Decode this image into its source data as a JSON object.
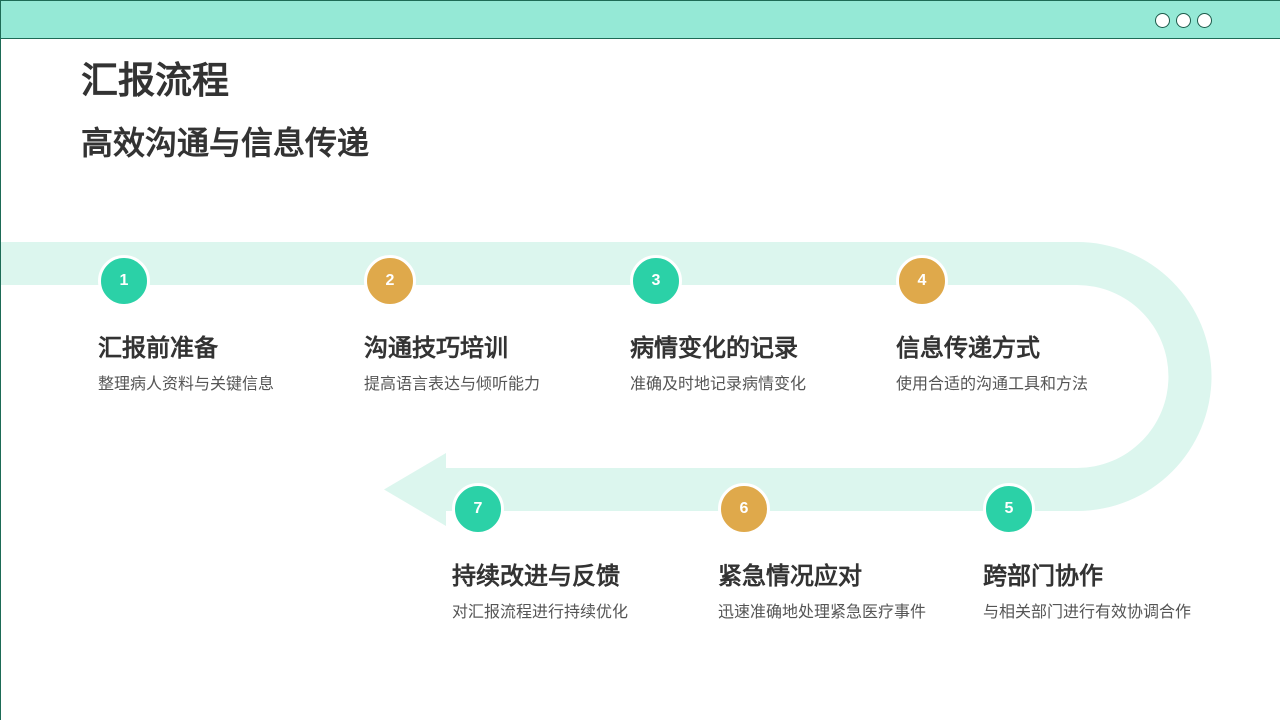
{
  "slide": {
    "title": "汇报流程",
    "subtitle": "高效沟通与信息传递"
  },
  "header": {
    "icons": [
      "circle-icon",
      "circle-icon",
      "circle-icon"
    ]
  },
  "colors": {
    "header_bar": "#95e9d6",
    "border": "#1d6b56",
    "path": "#dcf6ee",
    "accent_teal": "#2bd1a7",
    "accent_gold": "#dfa94b",
    "text_dark": "#333333",
    "text_muted": "#555555"
  },
  "steps": [
    {
      "number": "1",
      "title": "汇报前准备",
      "description": "整理病人资料与关键信息",
      "color": "#2bd1a7"
    },
    {
      "number": "2",
      "title": "沟通技巧培训",
      "description": "提高语言表达与倾听能力",
      "color": "#dfa94b"
    },
    {
      "number": "3",
      "title": "病情变化的记录",
      "description": "准确及时地记录病情变化",
      "color": "#2bd1a7"
    },
    {
      "number": "4",
      "title": "信息传递方式",
      "description": "使用合适的沟通工具和方法",
      "color": "#dfa94b"
    },
    {
      "number": "5",
      "title": "跨部门协作",
      "description": "与相关部门进行有效协调合作",
      "color": "#2bd1a7"
    },
    {
      "number": "6",
      "title": "紧急情况应对",
      "description": "迅速准确地处理紧急医疗事件",
      "color": "#dfa94b"
    },
    {
      "number": "7",
      "title": "持续改进与反馈",
      "description": "对汇报流程进行持续优化",
      "color": "#2bd1a7"
    }
  ]
}
